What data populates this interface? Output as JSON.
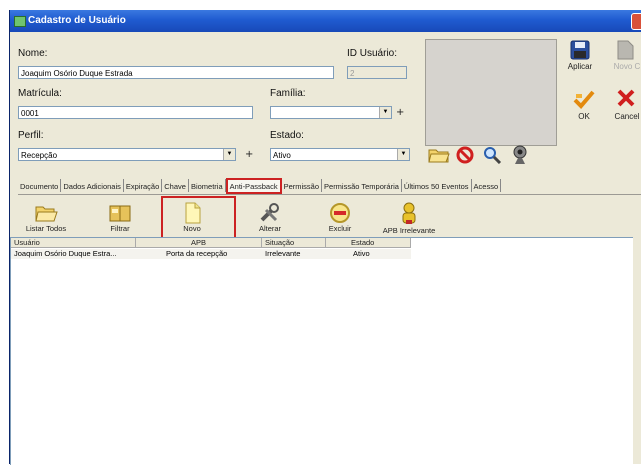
{
  "window": {
    "title": "Cadastro de Usuário"
  },
  "form": {
    "nome_label": "Nome:",
    "nome_value": "Joaquim Osório Duque Estrada",
    "id_label": "ID Usuário:",
    "id_value": "2",
    "matricula_label": "Matrícula:",
    "matricula_value": "0001",
    "familia_label": "Família:",
    "familia_value": "",
    "perfil_label": "Perfil:",
    "perfil_value": "Recepção",
    "estado_label": "Estado:",
    "estado_value": "Ativo",
    "plus": "+"
  },
  "actions": {
    "aplicar": "Aplicar",
    "novo": "Novo C",
    "ok": "OK",
    "cancelar": "Cancel"
  },
  "tabs": [
    "Documento",
    "Dados Adicionais",
    "Expiração",
    "Chave",
    "Biometria",
    "Anti-Passback",
    "Permissão",
    "Permissão Temporária",
    "Últimos 50 Eventos",
    "Acesso"
  ],
  "selected_tab": "Anti-Passback",
  "toolbar": {
    "listar": "Listar Todos",
    "filtrar": "Filtrar",
    "novo": "Novo",
    "alterar": "Alterar",
    "excluir": "Excluir",
    "apb": "APB Irrelevante"
  },
  "grid": {
    "headers": [
      "Usuário",
      "APB",
      "Situação",
      "Estado"
    ],
    "rows": [
      [
        "Joaquim Osório Duque Estra...",
        "Porta da recepção",
        "Irrelevante",
        "Ativo"
      ]
    ]
  },
  "colors": {
    "titlebar": "#1f5bd0",
    "highlight": "#cc2222",
    "window_bg": "#ece9d8"
  }
}
